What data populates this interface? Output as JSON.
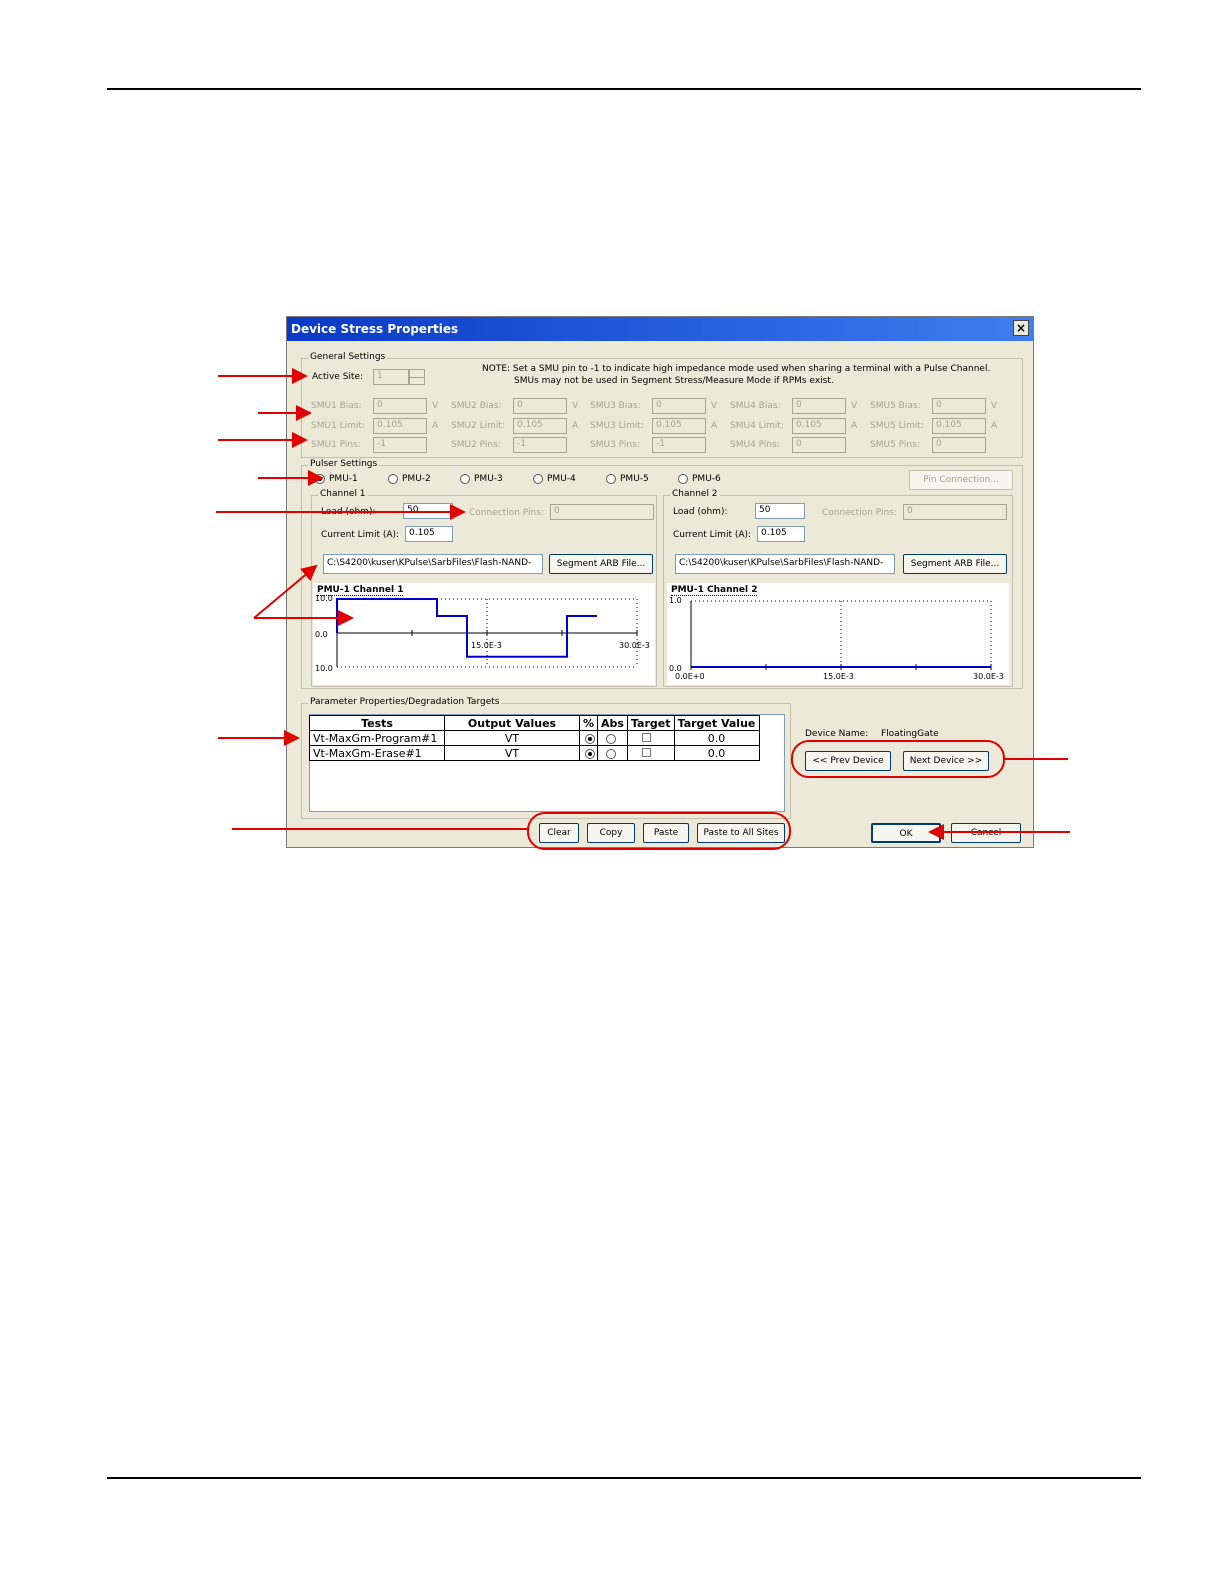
{
  "dialog": {
    "title": "Device Stress Properties",
    "close_glyph": "×"
  },
  "general": {
    "label": "General Settings",
    "active_site_label": "Active Site:",
    "active_site_value": "1",
    "note_line1": "NOTE: Set a SMU pin to -1 to indicate high impedance mode used when sharing a terminal with a Pulse Channel.",
    "note_line2": "SMUs may not be used in Segment Stress/Measure Mode if RPMs exist.",
    "smus": [
      {
        "bias_label": "SMU1 Bias:",
        "bias": "0",
        "bias_unit": "V",
        "limit_label": "SMU1 Limit:",
        "limit": "0.105",
        "limit_unit": "A",
        "pins_label": "SMU1 Pins:",
        "pins": "-1"
      },
      {
        "bias_label": "SMU2 Bias:",
        "bias": "0",
        "bias_unit": "V",
        "limit_label": "SMU2 Limit:",
        "limit": "0.105",
        "limit_unit": "A",
        "pins_label": "SMU2 Pins:",
        "pins": "-1"
      },
      {
        "bias_label": "SMU3 Bias:",
        "bias": "0",
        "bias_unit": "V",
        "limit_label": "SMU3 Limit:",
        "limit": "0.105",
        "limit_unit": "A",
        "pins_label": "SMU3 Pins:",
        "pins": "-1"
      },
      {
        "bias_label": "SMU4 Bias:",
        "bias": "0",
        "bias_unit": "V",
        "limit_label": "SMU4 Limit:",
        "limit": "0.105",
        "limit_unit": "A",
        "pins_label": "SMU4 Pins:",
        "pins": "0"
      },
      {
        "bias_label": "SMU5 Bias:",
        "bias": "0",
        "bias_unit": "V",
        "limit_label": "SMU5 Limit:",
        "limit": "0.105",
        "limit_unit": "A",
        "pins_label": "SMU5 Pins:",
        "pins": "0"
      }
    ]
  },
  "pulser": {
    "label": "Pulser Settings",
    "pmus": [
      "PMU-1",
      "PMU-2",
      "PMU-3",
      "PMU-4",
      "PMU-5",
      "PMU-6"
    ],
    "selected": "PMU-1",
    "pin_connection_label": "Pin Connection...",
    "channels": [
      {
        "label": "Channel 1",
        "load_label": "Load (ohm):",
        "load": "50",
        "conn_label": "Connection Pins:",
        "conn": "0",
        "limit_label": "Current Limit (A):",
        "limit": "0.105",
        "file": "C:\\S4200\\kuser\\KPulse\\SarbFiles\\Flash-NAND-",
        "arb_label": "Segment ARB File..."
      },
      {
        "label": "Channel 2",
        "load_label": "Load (ohm):",
        "load": "50",
        "conn_label": "Connection Pins:",
        "conn": "0",
        "limit_label": "Current Limit (A):",
        "limit": "0.105",
        "file": "C:\\S4200\\kuser\\KPulse\\SarbFiles\\Flash-NAND-",
        "arb_label": "Segment ARB File..."
      }
    ]
  },
  "chart_data": [
    {
      "type": "line",
      "title": "PMU-1 Channel 1",
      "color": "#0000cc",
      "x": [
        0,
        0.0,
        0.01,
        0.01,
        0.013,
        0.013,
        0.023,
        0.023,
        0.026
      ],
      "y": [
        0,
        10,
        10,
        5,
        5,
        -7,
        -7,
        5,
        5
      ],
      "xlim": [
        0,
        0.03
      ],
      "ylim": [
        -10,
        10
      ],
      "ytick_labels": [
        "10.0",
        "0.0",
        "10.0"
      ],
      "xtick_labels": [
        "15.0E-3",
        "30.0E-3"
      ]
    },
    {
      "type": "line",
      "title": "PMU-1 Channel 2",
      "color": "#0000cc",
      "x": [
        0,
        0.03
      ],
      "y": [
        0,
        0
      ],
      "xlim": [
        0,
        0.03
      ],
      "ylim": [
        0,
        1
      ],
      "ytick_labels": [
        "1.0",
        "0.0"
      ],
      "xtick_labels": [
        "0.0E+0",
        "15.0E-3",
        "30.0E-3"
      ]
    }
  ],
  "params": {
    "label": "Parameter Properties/Degradation Targets",
    "headers": [
      "Tests",
      "Output Values",
      "%",
      "Abs",
      "Target",
      "Target Value"
    ],
    "rows": [
      {
        "test": "Vt-MaxGm-Program#1",
        "output": "VT",
        "pct": true,
        "target_value": "0.0"
      },
      {
        "test": "Vt-MaxGm-Erase#1",
        "output": "VT",
        "pct": true,
        "target_value": "0.0"
      }
    ]
  },
  "device": {
    "name_label": "Device Name:",
    "name": "FloatingGate",
    "prev_label": "<< Prev Device",
    "next_label": "Next Device >>"
  },
  "buttons": {
    "clear": "Clear",
    "copy": "Copy",
    "paste": "Paste",
    "paste_all": "Paste to All Sites",
    "ok": "OK",
    "cancel": "Cancel"
  },
  "annotation_color": "#e00000"
}
